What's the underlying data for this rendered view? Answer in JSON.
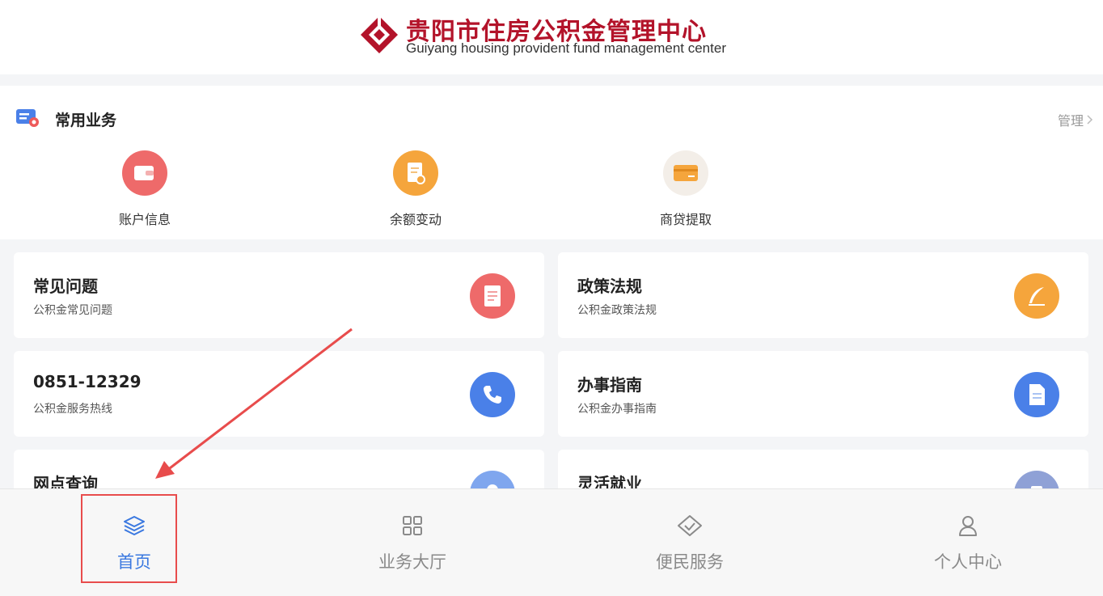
{
  "header": {
    "title_cn": "贵阳市住房公积金管理中心",
    "title_en": "Guiyang housing provident fund management center",
    "brand_color": "#b3132a"
  },
  "common_services": {
    "title": "常用业务",
    "manage_label": "管理",
    "items": [
      {
        "label": "账户信息",
        "icon": "wallet-icon",
        "color": "#ee6a6a"
      },
      {
        "label": "余额变动",
        "icon": "balance-document-icon",
        "color": "#f5a53c"
      },
      {
        "label": "商贷提取",
        "icon": "card-icon",
        "color": "#f5a53c"
      }
    ]
  },
  "cards": [
    {
      "title": "常见问题",
      "subtitle": "公积金常见问题",
      "icon": "faq-document-icon",
      "color": "#ee6a6a"
    },
    {
      "title": "政策法规",
      "subtitle": "公积金政策法规",
      "icon": "quill-icon",
      "color": "#f5a53c"
    },
    {
      "title": "0851-12329",
      "subtitle": "公积金服务热线",
      "icon": "phone-icon",
      "color": "#4a80e8"
    },
    {
      "title": "办事指南",
      "subtitle": "公积金办事指南",
      "icon": "guide-document-icon",
      "color": "#4a80e8"
    },
    {
      "title": "网点查询",
      "subtitle": "",
      "icon": "location-icon",
      "color": "#4a80e8"
    },
    {
      "title": "灵活就业",
      "subtitle": "",
      "icon": "employment-icon",
      "color": "#5a6fb0"
    }
  ],
  "nav": {
    "items": [
      {
        "label": "首页",
        "icon": "layers-icon",
        "active": true
      },
      {
        "label": "业务大厅",
        "icon": "grid-icon",
        "active": false
      },
      {
        "label": "便民服务",
        "icon": "handshake-icon",
        "active": false
      },
      {
        "label": "个人中心",
        "icon": "person-icon",
        "active": false
      }
    ],
    "active_color": "#3a78e0",
    "inactive_color": "#8a8a8a"
  },
  "annotation": {
    "color": "#e84c4c"
  }
}
